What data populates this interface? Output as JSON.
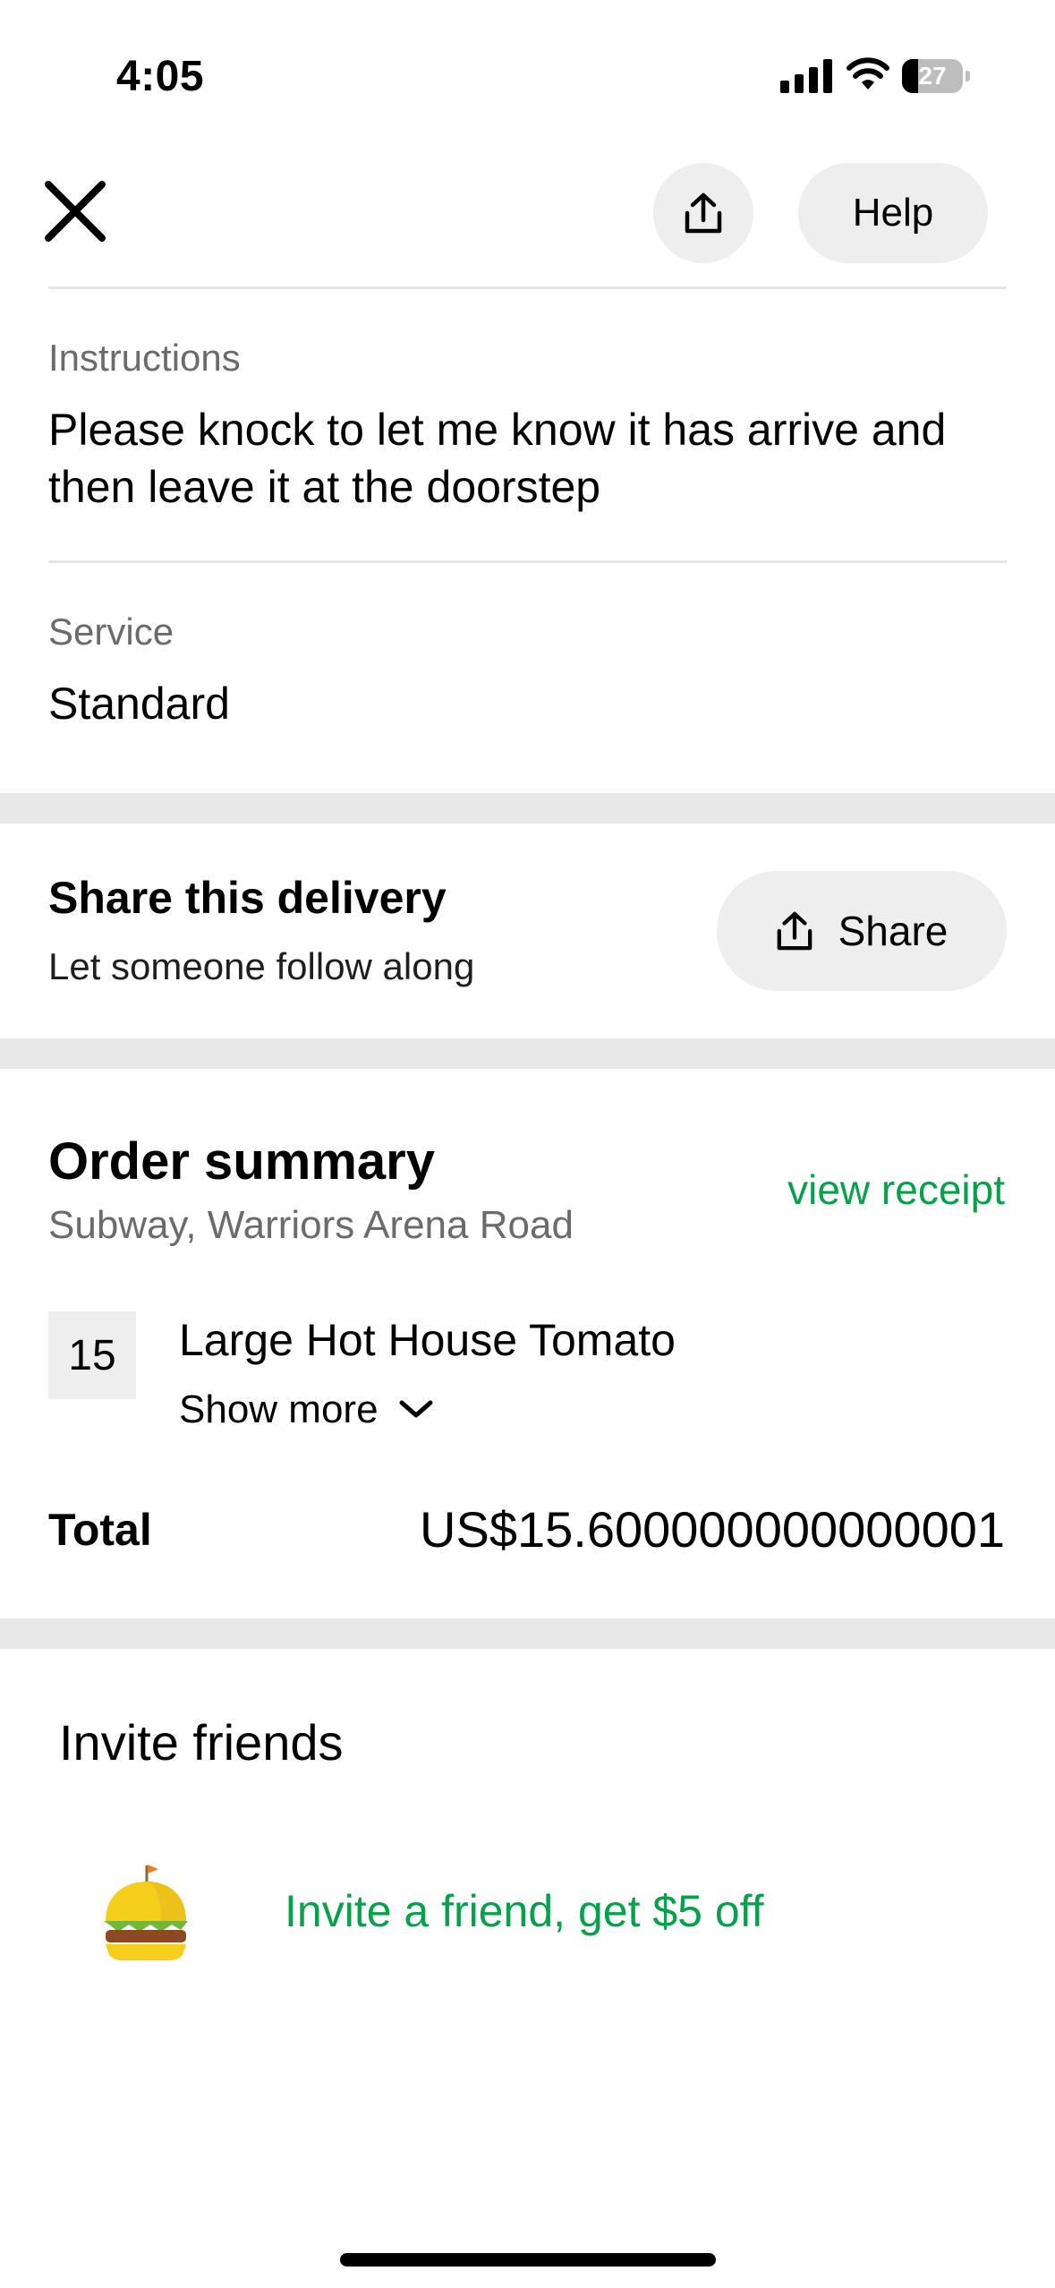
{
  "status_bar": {
    "time": "4:05",
    "battery": "27",
    "battery_level": 0.27
  },
  "header": {
    "help_label": "Help"
  },
  "instructions": {
    "label": "Instructions",
    "text_line1": "Please knock to let me know it has arrive and",
    "text_line2": "then leave it at the doorstep"
  },
  "service": {
    "label": "Service",
    "value": "Standard"
  },
  "share_delivery": {
    "title": "Share this delivery",
    "subtitle": "Let someone follow along",
    "button_label": "Share"
  },
  "order_summary": {
    "title": "Order summary",
    "store": "Subway, Warriors Arena Road",
    "view_receipt": "view receipt",
    "items": [
      {
        "qty": "15",
        "name": "Large Hot House Tomato",
        "show_more": "Show more"
      }
    ],
    "total_label": "Total",
    "total_value": "US$15.600000000000001"
  },
  "invite": {
    "title": "Invite friends",
    "promo": "Invite a friend, get $5 off",
    "icon": "burger-icon"
  },
  "colors": {
    "accent_green": "#06a24b",
    "pill_bg": "#eeeeee",
    "divider": "#e6e6e6"
  }
}
